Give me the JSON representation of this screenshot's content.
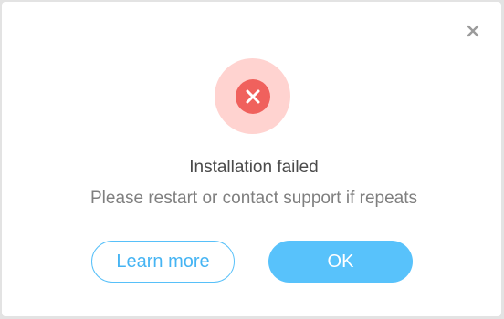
{
  "dialog": {
    "title": "Installation failed",
    "message": "Please restart or contact support if repeats",
    "close_icon": "close-icon",
    "status_icon": "error-x-icon",
    "buttons": {
      "learn_more_label": "Learn more",
      "ok_label": "OK"
    }
  },
  "colors": {
    "accent": "#58c2fb",
    "error": "#f0615d",
    "error_halo": "#ffd3d0",
    "title_text": "#4a4a4a",
    "body_text": "#7f7f7f"
  }
}
